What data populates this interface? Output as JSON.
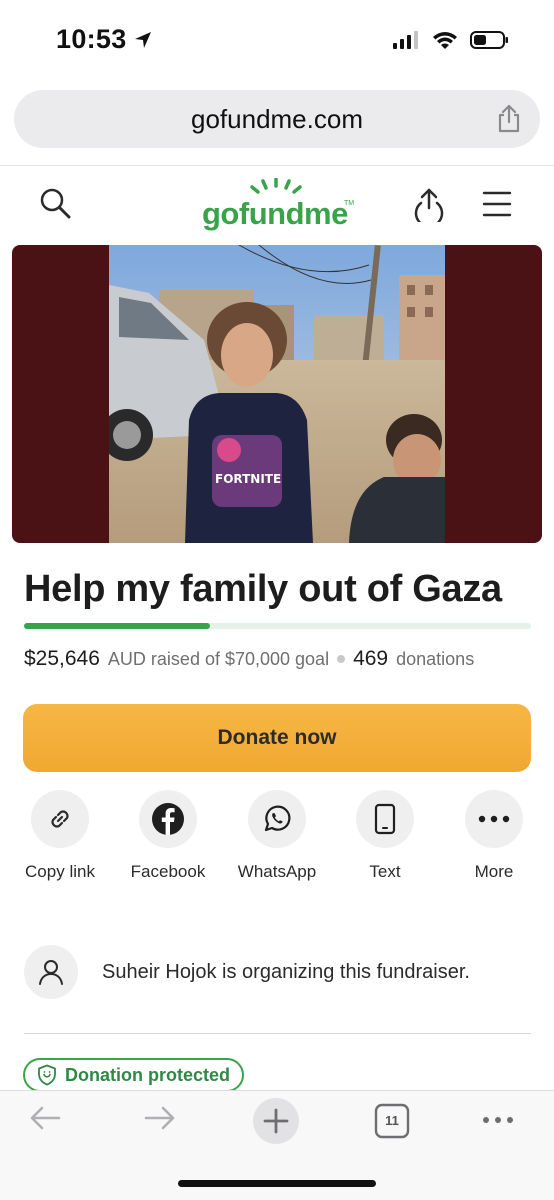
{
  "status_bar": {
    "time": "10:53",
    "icons": [
      "location-arrow-icon",
      "cellular-signal-icon",
      "wifi-icon",
      "battery-icon"
    ]
  },
  "browser": {
    "url": "gofundme.com",
    "share_icon": "share-icon"
  },
  "site_header": {
    "logo_text": "gofundme",
    "logo_tm": "TM",
    "brand_color": "#3aa34a",
    "icons": [
      "search-icon",
      "upload-icon",
      "hamburger-menu-icon"
    ]
  },
  "hero": {
    "image_overlay_text": "FORTNITE"
  },
  "fundraiser": {
    "title": "Help my family out of Gaza",
    "raised_amount": "$25,646",
    "raised_text": "AUD raised of $70,000 goal",
    "donations_count": "469",
    "donations_text": "donations",
    "progress_fraction": 0.366
  },
  "donate_button": {
    "label": "Donate now",
    "color": "#f2ae3a"
  },
  "share_options": [
    {
      "label": "Copy link",
      "icon": "link-icon"
    },
    {
      "label": "Facebook",
      "icon": "facebook-icon"
    },
    {
      "label": "WhatsApp",
      "icon": "whatsapp-icon"
    },
    {
      "label": "Text",
      "icon": "phone-icon"
    },
    {
      "label": "More",
      "icon": "more-dots-icon"
    }
  ],
  "organizer": {
    "text": "Suheir Hojok is organizing this fundraiser.",
    "icon": "user-icon"
  },
  "badge": {
    "label": "Donation protected",
    "icon": "shield-icon"
  },
  "toolbar": {
    "tab_count": "11",
    "icons": [
      "back-arrow-icon",
      "forward-arrow-icon",
      "new-tab-plus-icon",
      "tabs-icon",
      "more-icon"
    ]
  }
}
